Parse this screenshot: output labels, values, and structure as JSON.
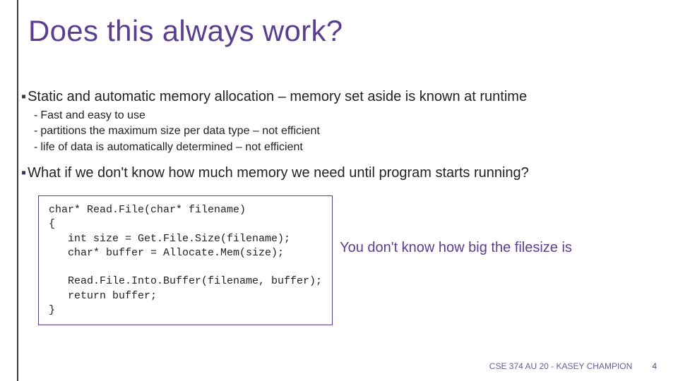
{
  "title": "Does this always work?",
  "points": {
    "p1": "Static and automatic memory allocation – memory set aside is known at runtime",
    "p1_subs": {
      "s1": "Fast and easy to use",
      "s2": "partitions the maximum size per data type – not efficient",
      "s3": "life of data is automatically determined – not efficient"
    },
    "p2": "What if we don't know how much memory we need until program starts running?"
  },
  "code": "char* Read.File(char* filename)\n{\n   int size = Get.File.Size(filename);\n   char* buffer = Allocate.Mem(size);\n\n   Read.File.Into.Buffer(filename, buffer);\n   return buffer;\n}",
  "annotation": "You don't know how big the filesize is",
  "footer": {
    "course": "CSE 374 AU 20 - KASEY CHAMPION",
    "page": "4"
  }
}
